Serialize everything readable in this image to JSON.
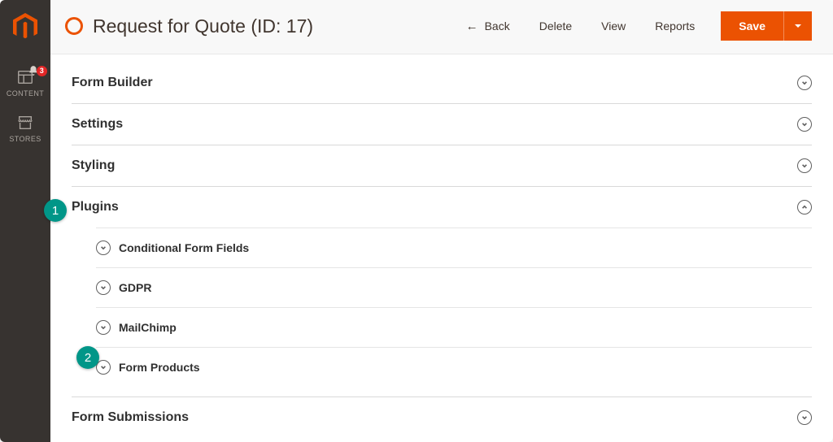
{
  "sidebar": {
    "items": [
      {
        "label": "CONTENT",
        "badge": "3"
      },
      {
        "label": "STORES"
      }
    ]
  },
  "topbar": {
    "title": "Request for Quote (ID: 17)",
    "actions": {
      "back": "Back",
      "delete": "Delete",
      "view": "View",
      "reports": "Reports",
      "save": "Save"
    }
  },
  "sections": [
    {
      "title": "Form Builder",
      "expanded": false
    },
    {
      "title": "Settings",
      "expanded": false
    },
    {
      "title": "Styling",
      "expanded": false
    },
    {
      "title": "Plugins",
      "expanded": true,
      "children": [
        {
          "title": "Conditional Form Fields"
        },
        {
          "title": "GDPR"
        },
        {
          "title": "MailChimp"
        },
        {
          "title": "Form Products"
        }
      ]
    },
    {
      "title": "Form Submissions",
      "expanded": false
    }
  ],
  "markers": {
    "one": "1",
    "two": "2"
  }
}
